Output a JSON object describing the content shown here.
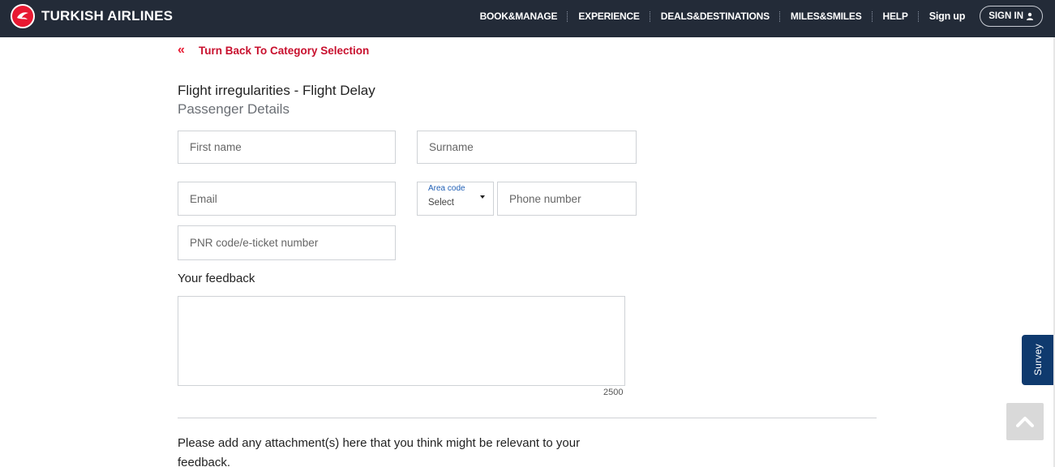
{
  "brand": {
    "name": "TURKISH AIRLINES",
    "accent": "#e81932",
    "header_bg": "#232b38"
  },
  "nav": {
    "items": [
      "BOOK&MANAGE",
      "EXPERIENCE",
      "DEALS&DESTINATIONS",
      "MILES&SMILES",
      "HELP",
      "Sign up"
    ],
    "signin_label": "SIGN IN"
  },
  "back_link": {
    "label": "Turn Back To Category Selection",
    "icon": "double-chevron-left-icon"
  },
  "form": {
    "title": "Flight irregularities - Flight Delay",
    "subtitle": "Passenger Details",
    "first_name": {
      "placeholder": "First name",
      "value": ""
    },
    "surname": {
      "placeholder": "Surname",
      "value": ""
    },
    "email": {
      "placeholder": "Email",
      "value": ""
    },
    "area_code": {
      "label": "Area code",
      "value": "Select"
    },
    "phone": {
      "placeholder": "Phone number",
      "value": ""
    },
    "pnr": {
      "placeholder": "PNR code/e-ticket number",
      "value": ""
    },
    "feedback_label": "Your feedback",
    "feedback_value": "",
    "char_remaining": "2500",
    "attachment_text": "Please add any attachment(s) here that you think might be relevant to your feedback."
  },
  "survey_tab": "Survey",
  "scroll_top_icon": "chevron-up-icon"
}
